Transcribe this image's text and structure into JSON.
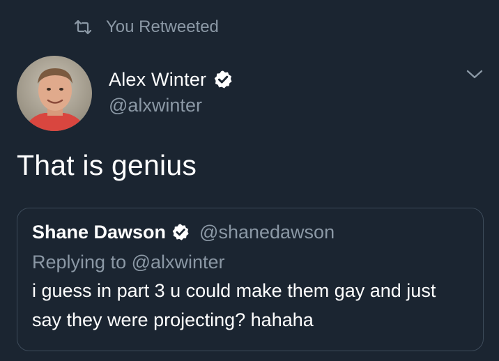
{
  "retweet": {
    "label": "You Retweeted",
    "icon": "retweet-icon"
  },
  "tweet": {
    "author_name": "Alex Winter",
    "author_handle": "@alxwinter",
    "verified": true,
    "text": "That is genius"
  },
  "quoted": {
    "author_name": "Shane Dawson",
    "author_handle": "@shanedawson",
    "verified": true,
    "reply_line": "Replying to @alxwinter",
    "text": "i guess in part 3 u could make them gay and just say they were projecting? hahaha"
  },
  "colors": {
    "background": "#1b2531",
    "secondary_text": "#8b98a5",
    "primary_text": "#ffffff",
    "card_border": "#3d4b5a"
  }
}
